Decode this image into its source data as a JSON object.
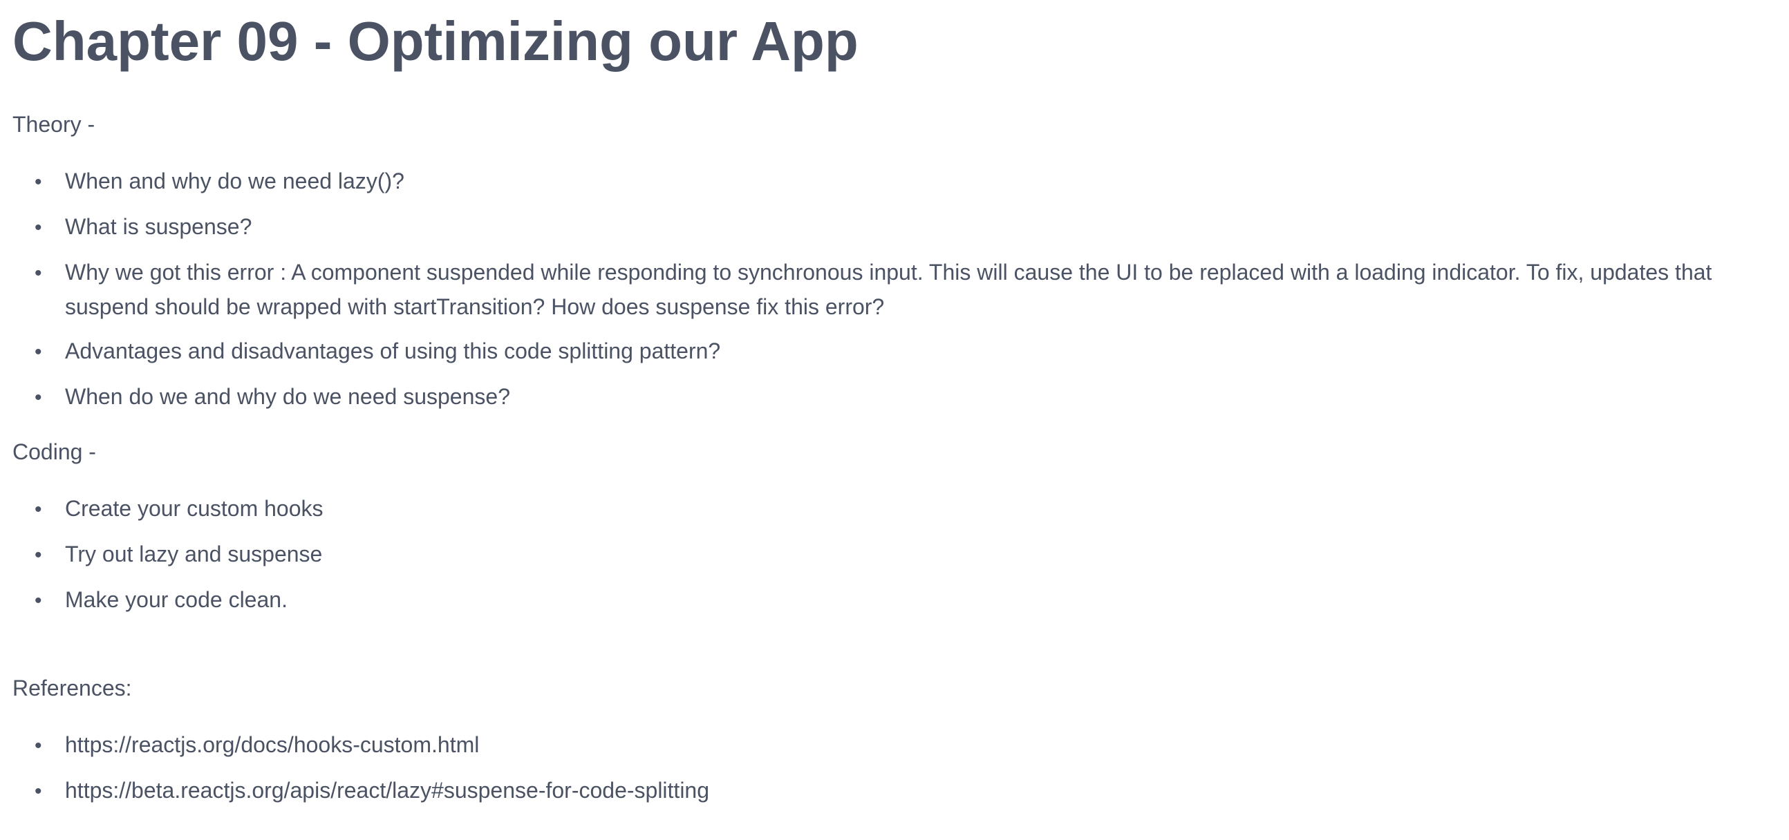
{
  "title": "Chapter 09 - Optimizing our App",
  "theory": {
    "heading": "Theory -",
    "items": [
      "When and why do we need lazy()?",
      "What is suspense?",
      "Why we got this error : A component suspended while responding to synchronous input. This will cause the UI to be replaced with a loading indicator. To fix, updates that suspend should be wrapped with startTransition? How does suspense fix this error?",
      "Advantages and disadvantages of using this code splitting pattern?",
      "When do we and why do we need suspense?"
    ]
  },
  "coding": {
    "heading": "Coding -",
    "items": [
      "Create your custom hooks",
      "Try out lazy and suspense",
      "Make your code clean."
    ]
  },
  "references": {
    "heading": "References:",
    "items": [
      "https://reactjs.org/docs/hooks-custom.html",
      "https://beta.reactjs.org/apis/react/lazy#suspense-for-code-splitting"
    ]
  },
  "bullet_glyph": "•"
}
